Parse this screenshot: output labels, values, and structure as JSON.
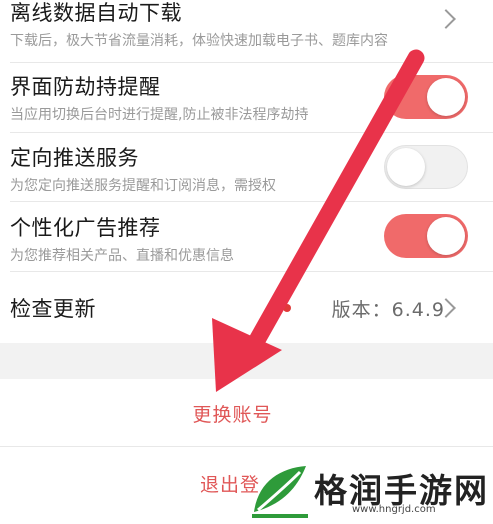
{
  "settings": {
    "offline": {
      "title": "离线数据自动下载",
      "subtitle": "下载后，极大节省流量消耗，体验快速加载电子书、题库内容"
    },
    "hijack": {
      "title": "界面防劫持提醒",
      "subtitle": "当应用切换后台时进行提醒,防止被非法程序劫持",
      "enabled": true
    },
    "push": {
      "title": "定向推送服务",
      "subtitle": "为您定向推送服务提醒和订阅消息，需授权",
      "enabled": false
    },
    "ads": {
      "title": "个性化广告推荐",
      "subtitle": "为您推荐相关产品、直播和优惠信息",
      "enabled": true
    },
    "update": {
      "title": "检查更新",
      "version": "版本：6.4.9"
    }
  },
  "actions": {
    "switch_account": "更换账号",
    "logout": "退出登"
  },
  "watermark": {
    "brand": "格润手游网",
    "url": "www.hngrjd.com"
  },
  "colors": {
    "accent": "#f06a6a",
    "arrow": "#e8334a",
    "action_text": "#e05757",
    "watermark_green": "#2e9b3a"
  },
  "icons": {
    "chevron": "chevron-right-icon",
    "logo": "leaf-logo-icon"
  }
}
